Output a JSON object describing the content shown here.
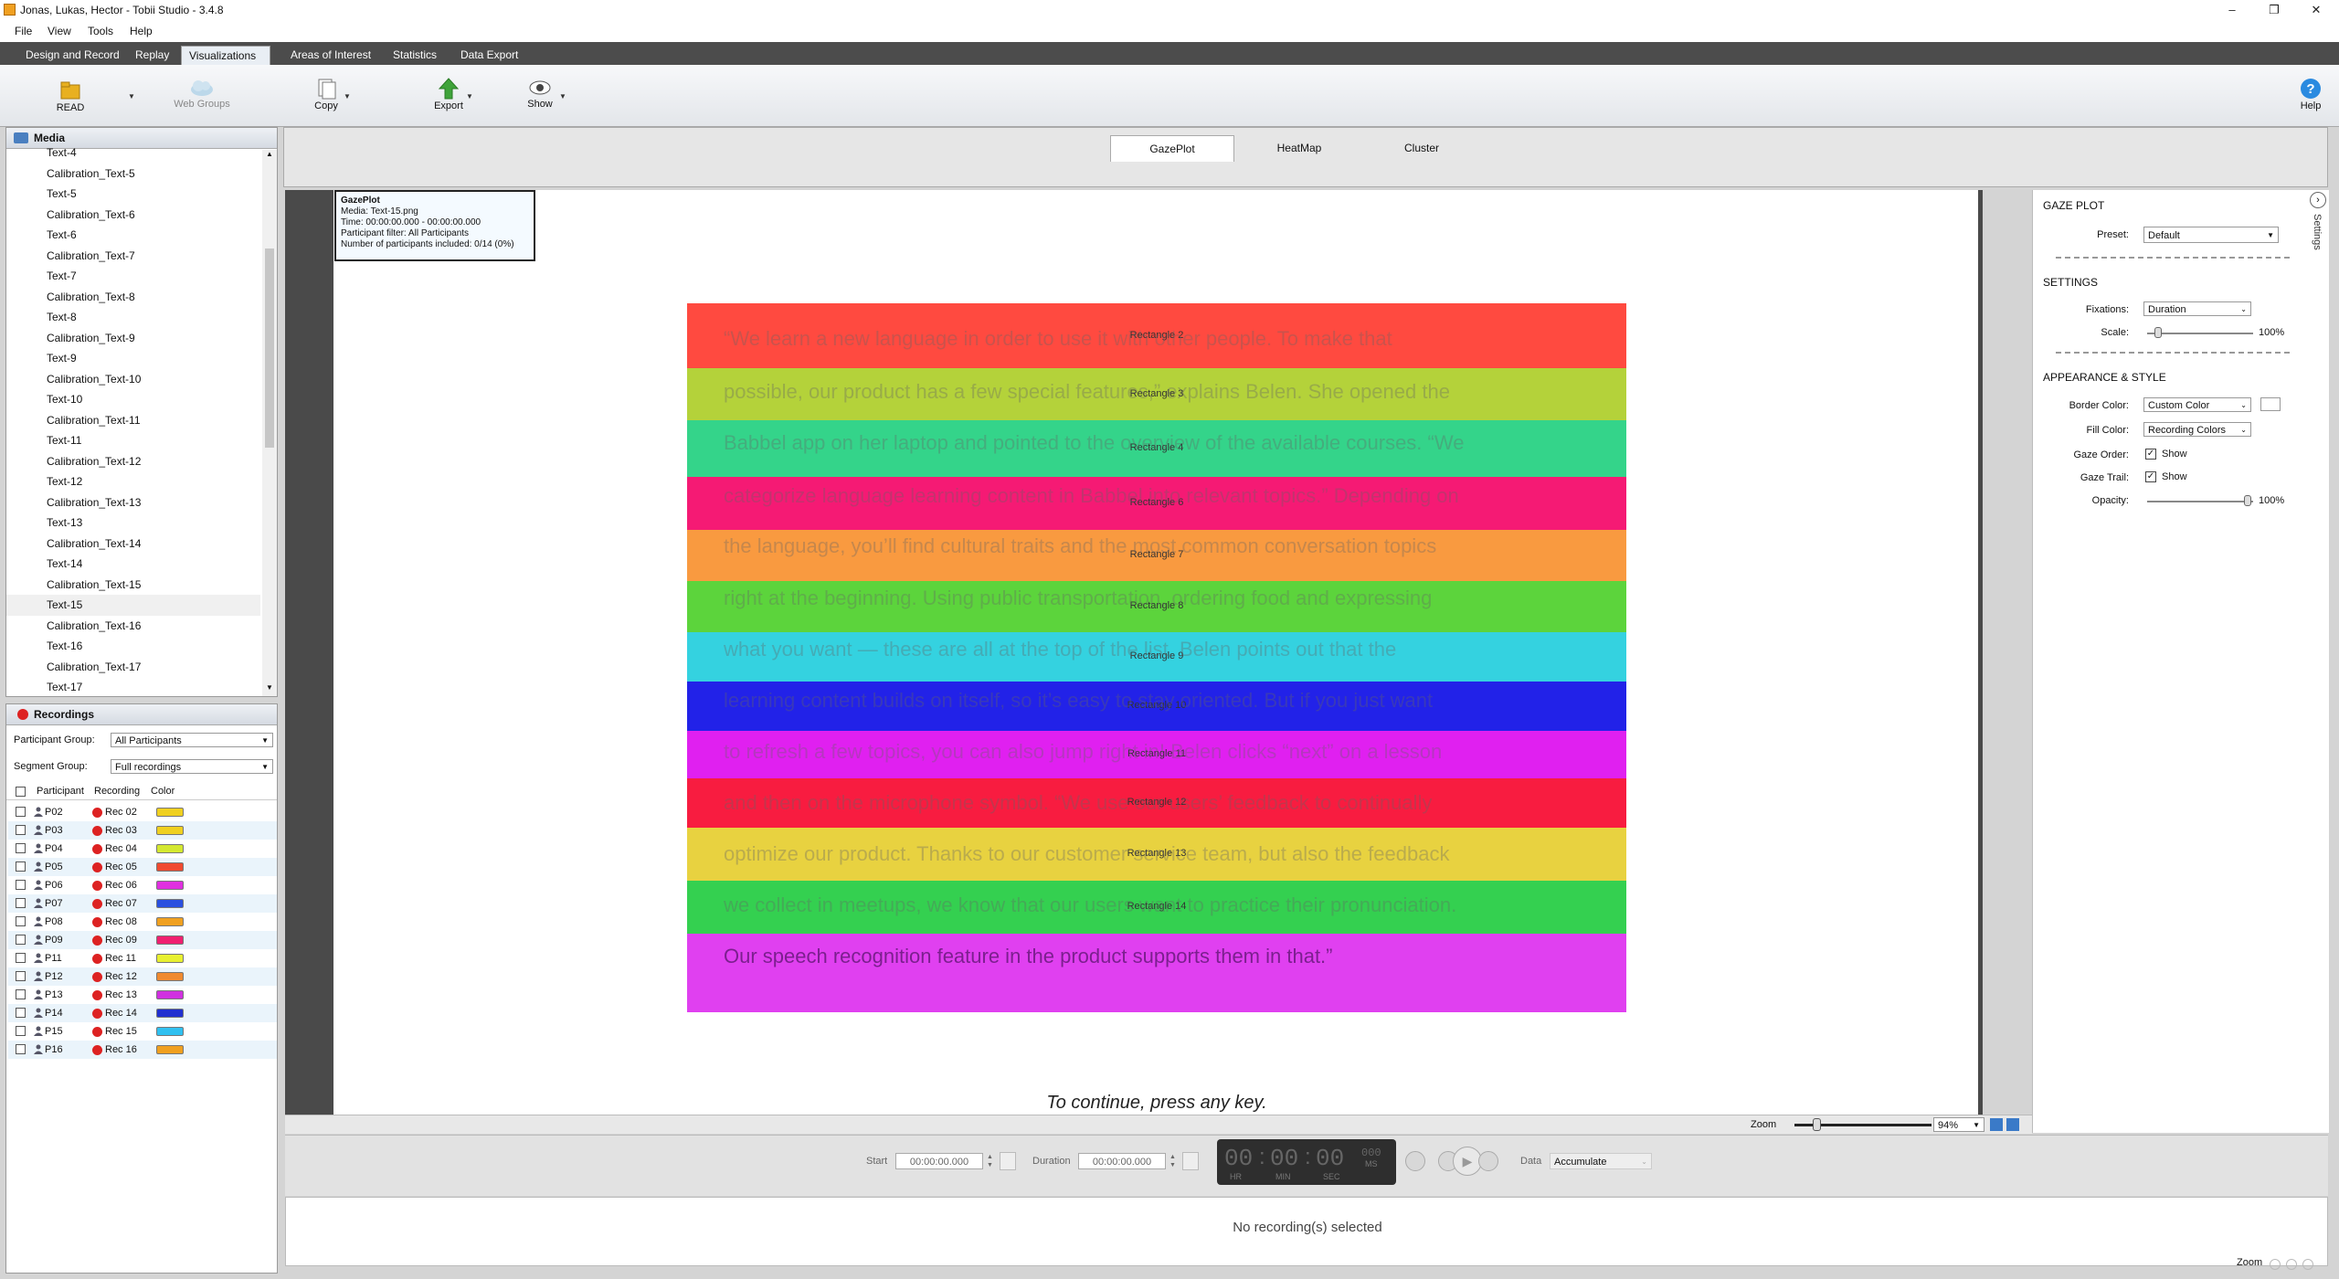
{
  "window": {
    "title": "Jonas, Lukas, Hector - Tobii Studio - 3.4.8",
    "minimize": "–",
    "maximize": "❐",
    "close": "✕"
  },
  "menu": [
    "File",
    "View",
    "Tools",
    "Help"
  ],
  "tabs": [
    "Design and Record",
    "Replay",
    "Visualizations",
    "Areas of Interest",
    "Statistics",
    "Data Export"
  ],
  "toolbar": {
    "read": "READ",
    "web_groups": "Web Groups",
    "copy": "Copy",
    "export": "Export",
    "show": "Show",
    "help": "Help"
  },
  "media": {
    "header": "Media",
    "items": [
      "Text-4",
      "Calibration_Text-5",
      "Text-5",
      "Calibration_Text-6",
      "Text-6",
      "Calibration_Text-7",
      "Text-7",
      "Calibration_Text-8",
      "Text-8",
      "Calibration_Text-9",
      "Text-9",
      "Calibration_Text-10",
      "Text-10",
      "Calibration_Text-11",
      "Text-11",
      "Calibration_Text-12",
      "Text-12",
      "Calibration_Text-13",
      "Text-13",
      "Calibration_Text-14",
      "Text-14",
      "Calibration_Text-15",
      "Text-15",
      "Calibration_Text-16",
      "Text-16",
      "Calibration_Text-17",
      "Text-17"
    ],
    "selected": "Text-15"
  },
  "recordings": {
    "header": "Recordings",
    "participant_group_label": "Participant Group:",
    "participant_group_value": "All Participants",
    "segment_group_label": "Segment Group:",
    "segment_group_value": "Full recordings",
    "columns": [
      "Participant",
      "Recording",
      "Color"
    ],
    "rows": [
      {
        "p": "P02",
        "r": "Rec 02",
        "color": "#f0d020"
      },
      {
        "p": "P03",
        "r": "Rec 03",
        "color": "#f0d020"
      },
      {
        "p": "P04",
        "r": "Rec 04",
        "color": "#d4e830"
      },
      {
        "p": "P05",
        "r": "Rec 05",
        "color": "#f04a30"
      },
      {
        "p": "P06",
        "r": "Rec 06",
        "color": "#e030e0"
      },
      {
        "p": "P07",
        "r": "Rec 07",
        "color": "#2a50e0"
      },
      {
        "p": "P08",
        "r": "Rec 08",
        "color": "#f0a020"
      },
      {
        "p": "P09",
        "r": "Rec 09",
        "color": "#f02070"
      },
      {
        "p": "P11",
        "r": "Rec 11",
        "color": "#e8f030"
      },
      {
        "p": "P12",
        "r": "Rec 12",
        "color": "#f08a30"
      },
      {
        "p": "P13",
        "r": "Rec 13",
        "color": "#d030e0"
      },
      {
        "p": "P14",
        "r": "Rec 14",
        "color": "#2030d0"
      },
      {
        "p": "P15",
        "r": "Rec 15",
        "color": "#30c0f0"
      },
      {
        "p": "P16",
        "r": "Rec 16",
        "color": "#f0a020"
      }
    ]
  },
  "viz_tabs": [
    "GazePlot",
    "HeatMap",
    "Cluster"
  ],
  "info_box": {
    "title": "GazePlot",
    "media": "Media: Text-15.png",
    "time": "Time: 00:00:00.000 - 00:00:00.000",
    "filter": "Participant filter: All Participants",
    "included": "Number of participants included: 0/14 (0%)"
  },
  "stimulus": {
    "rectangles": [
      {
        "label": "Rectangle 2",
        "color": "#ff4a40"
      },
      {
        "label": "Rectangle 3",
        "color": "#b4d23a"
      },
      {
        "label": "Rectangle 4",
        "color": "#34d48a"
      },
      {
        "label": "Rectangle 6",
        "color": "#f51a74"
      },
      {
        "label": "Rectangle 7",
        "color": "#f99a40"
      },
      {
        "label": "Rectangle 8",
        "color": "#5cd43c"
      },
      {
        "label": "Rectangle 9",
        "color": "#34d2e0"
      },
      {
        "label": "Rectangle 10",
        "color": "#2222e8"
      },
      {
        "label": "Rectangle 11",
        "color": "#e020f0"
      },
      {
        "label": "Rectangle 12",
        "color": "#f81c40"
      },
      {
        "label": "Rectangle 13",
        "color": "#e8d240"
      },
      {
        "label": "Rectangle 14",
        "color": "#34d050"
      },
      {
        "label": "",
        "color": "#e040f0"
      }
    ],
    "text_lines": [
      "“We learn a new language in order to use it with other people. To make that",
      "possible, our product has a few special features,” explains Belen. She opened the",
      "Babbel app on her laptop and pointed to the overview of the available courses. “We",
      "categorize language learning content in Babbel into relevant topics.” Depending on",
      "the language, you’ll find cultural traits and the most common conversation topics",
      "right at the beginning. Using public transportation, ordering food and expressing",
      "what you want — these are all at the top of the list. Belen points out that the",
      "learning content builds on itself, so it’s easy to stay oriented. But if you just want",
      "to refresh a few topics, you can also jump right in! Belen clicks “next” on a lesson",
      "and then on the microphone symbol. “We use our users’ feedback to continually",
      "optimize our product. Thanks to our customer service team, but also the feedback",
      "we collect in meetups, we know that our users want to practice their pronunciation.",
      "Our speech recognition feature in the product supports them in that.”"
    ],
    "continue_text": "To continue, press any key."
  },
  "zoom": {
    "label": "Zoom",
    "value": "94%"
  },
  "settings": {
    "gaze_plot_header": "GAZE PLOT",
    "preset_label": "Preset:",
    "preset_value": "Default",
    "settings_header": "SETTINGS",
    "fixations_label": "Fixations:",
    "fixations_value": "Duration",
    "scale_label": "Scale:",
    "scale_value": "100%",
    "appearance_header": "APPEARANCE & STYLE",
    "border_color_label": "Border Color:",
    "border_color_value": "Custom Color",
    "fill_color_label": "Fill Color:",
    "fill_color_value": "Recording Colors",
    "gaze_order_label": "Gaze Order:",
    "gaze_order_value": "Show",
    "gaze_trail_label": "Gaze Trail:",
    "gaze_trail_value": "Show",
    "opacity_label": "Opacity:",
    "opacity_value": "100%",
    "side_tab": "Settings"
  },
  "playback": {
    "start_label": "Start",
    "start_value": "00:00:00.000",
    "duration_label": "Duration",
    "duration_value": "00:00:00.000",
    "clock_hr": "00",
    "clock_min": "00",
    "clock_sec": "00",
    "clock_ms": "000",
    "hr": "HR",
    "min": "MIN",
    "sec": "SEC",
    "ms": "MS",
    "data_label": "Data",
    "data_value": "Accumulate",
    "status": "No recording(s) selected",
    "bottom_zoom": "Zoom"
  }
}
